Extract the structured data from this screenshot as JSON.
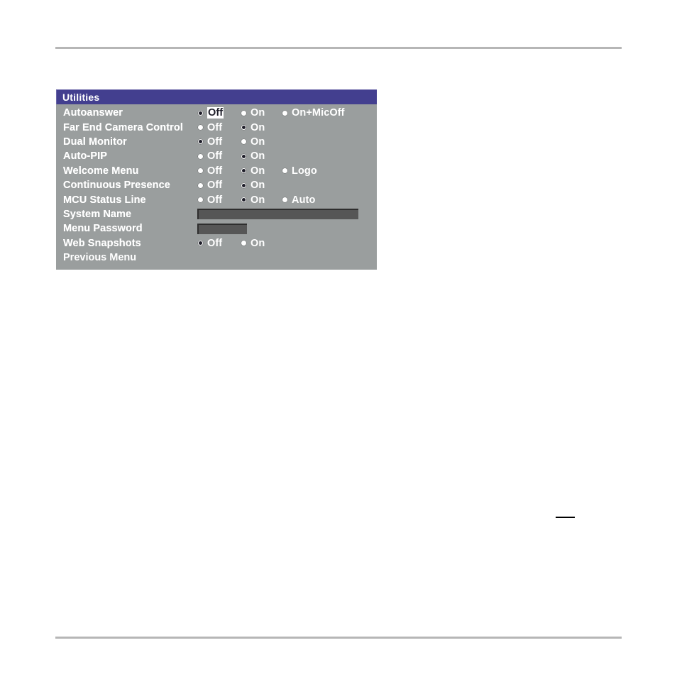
{
  "page": {
    "top_rule": "horizontal-rule",
    "bottom_rule": "horizontal-rule",
    "stray_mark": "underscore-mark"
  },
  "dialog": {
    "title": "Utilities",
    "rows": [
      {
        "label": "Autoanswer",
        "type": "radio",
        "options": [
          {
            "label": "Off",
            "selected": true,
            "focused": true
          },
          {
            "label": "On",
            "selected": false,
            "focused": false
          },
          {
            "label": "On+MicOff",
            "selected": false,
            "focused": false
          }
        ]
      },
      {
        "label": "Far End Camera Control",
        "type": "radio",
        "options": [
          {
            "label": "Off",
            "selected": false,
            "focused": false
          },
          {
            "label": "On",
            "selected": true,
            "focused": false
          }
        ]
      },
      {
        "label": "Dual Monitor",
        "type": "radio",
        "options": [
          {
            "label": "Off",
            "selected": true,
            "focused": false
          },
          {
            "label": "On",
            "selected": false,
            "focused": false
          }
        ]
      },
      {
        "label": "Auto-PIP",
        "type": "radio",
        "options": [
          {
            "label": "Off",
            "selected": false,
            "focused": false
          },
          {
            "label": "On",
            "selected": true,
            "focused": false
          }
        ]
      },
      {
        "label": "Welcome Menu",
        "type": "radio",
        "options": [
          {
            "label": "Off",
            "selected": false,
            "focused": false
          },
          {
            "label": "On",
            "selected": true,
            "focused": false
          },
          {
            "label": "Logo",
            "selected": false,
            "focused": false
          }
        ]
      },
      {
        "label": "Continuous Presence",
        "type": "radio",
        "options": [
          {
            "label": "Off",
            "selected": false,
            "focused": false
          },
          {
            "label": "On",
            "selected": true,
            "focused": false
          }
        ]
      },
      {
        "label": "MCU Status Line",
        "type": "radio",
        "options": [
          {
            "label": "Off",
            "selected": false,
            "focused": false
          },
          {
            "label": "On",
            "selected": true,
            "focused": false
          },
          {
            "label": "Auto",
            "selected": false,
            "focused": false
          }
        ]
      },
      {
        "label": "System Name",
        "type": "text",
        "value": "",
        "width": "wide"
      },
      {
        "label": "Menu Password",
        "type": "text",
        "value": "",
        "width": "narrow"
      },
      {
        "label": "Web Snapshots",
        "type": "radio",
        "options": [
          {
            "label": "Off",
            "selected": true,
            "focused": false
          },
          {
            "label": "On",
            "selected": false,
            "focused": false
          }
        ]
      },
      {
        "label": "Previous Menu",
        "type": "action"
      }
    ]
  },
  "colors": {
    "titlebar": "#433f8f",
    "dialog_bg": "#9a9e9e",
    "field_bg": "#565656",
    "label_text": "#ffffff",
    "focus_bg": "#ffffff",
    "focus_text": "#1d1d28",
    "rule": "#b6b6b6"
  }
}
